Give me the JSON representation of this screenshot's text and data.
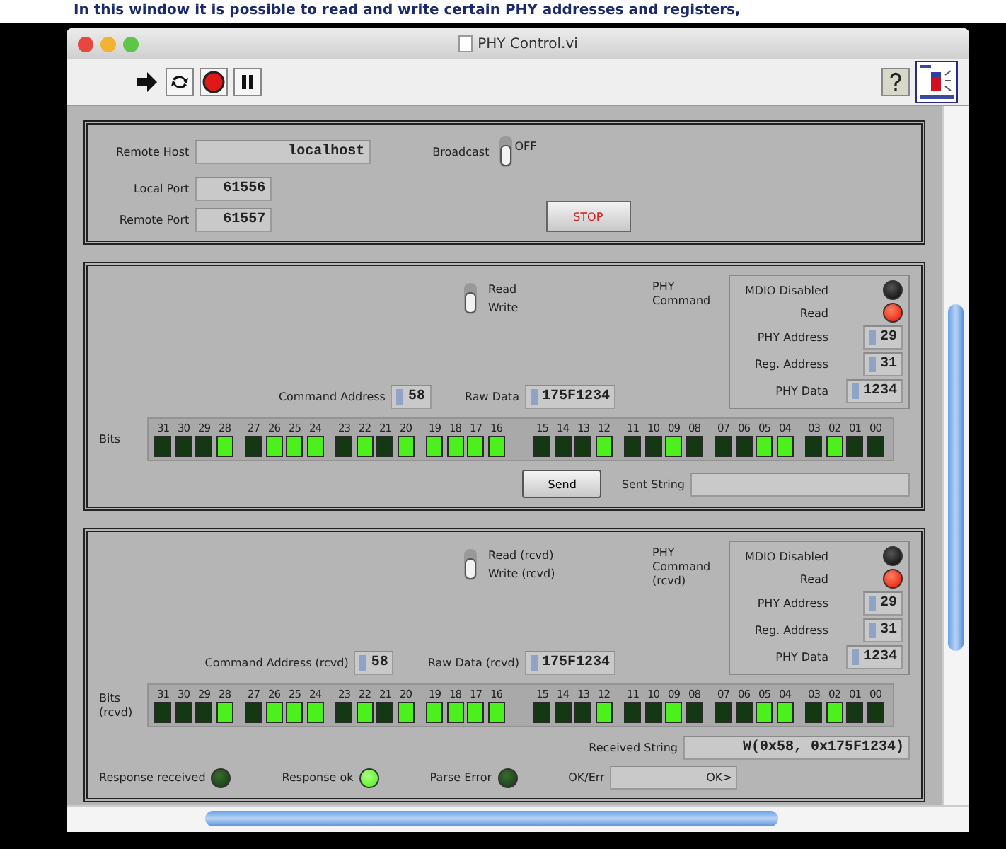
{
  "caption": "In this window it is possible to read and write certain PHY addresses and registers,",
  "window": {
    "title": "PHY Control.vi"
  },
  "connection": {
    "remote_host": {
      "label": "Remote Host",
      "value": "localhost"
    },
    "local_port": {
      "label": "Local Port",
      "value": "61556"
    },
    "remote_port": {
      "label": "Remote Port",
      "value": "61557"
    },
    "broadcast": {
      "label": "Broadcast",
      "state": "OFF",
      "on": false
    },
    "stop_button": "STOP"
  },
  "send": {
    "switch": {
      "top_label": "Read",
      "bottom_label": "Write",
      "down": true
    },
    "command_label": "PHY Command",
    "mdio": {
      "leds": [
        {
          "label": "MDIO Disabled",
          "on": false
        },
        {
          "label": "Read",
          "on": true
        }
      ],
      "fields": [
        {
          "label": "PHY Address",
          "value": "29"
        },
        {
          "label": "Reg. Address",
          "value": "31"
        },
        {
          "label": "PHY Data",
          "value": "1234"
        }
      ]
    },
    "command_address": {
      "label": "Command Address",
      "value": "58"
    },
    "raw_data": {
      "label": "Raw Data",
      "value": "175F1234"
    },
    "bits_label": "Bits",
    "bits": [
      {
        "label": "31",
        "on": false
      },
      {
        "label": "30",
        "on": false
      },
      {
        "label": "29",
        "on": false
      },
      {
        "label": "28",
        "on": true
      },
      {
        "label": "27",
        "on": false
      },
      {
        "label": "26",
        "on": true
      },
      {
        "label": "25",
        "on": true
      },
      {
        "label": "24",
        "on": true
      },
      {
        "label": "23",
        "on": false
      },
      {
        "label": "22",
        "on": true
      },
      {
        "label": "21",
        "on": false
      },
      {
        "label": "20",
        "on": true
      },
      {
        "label": "19",
        "on": true
      },
      {
        "label": "18",
        "on": true
      },
      {
        "label": "17",
        "on": true
      },
      {
        "label": "16",
        "on": true
      },
      {
        "label": "15",
        "on": false
      },
      {
        "label": "14",
        "on": false
      },
      {
        "label": "13",
        "on": false
      },
      {
        "label": "12",
        "on": true
      },
      {
        "label": "11",
        "on": false
      },
      {
        "label": "10",
        "on": false
      },
      {
        "label": "09",
        "on": true
      },
      {
        "label": "08",
        "on": false
      },
      {
        "label": "07",
        "on": false
      },
      {
        "label": "06",
        "on": false
      },
      {
        "label": "05",
        "on": true
      },
      {
        "label": "04",
        "on": true
      },
      {
        "label": "03",
        "on": false
      },
      {
        "label": "02",
        "on": true
      },
      {
        "label": "01",
        "on": false
      },
      {
        "label": "00",
        "on": false
      }
    ],
    "send_button": "Send",
    "sent_string": {
      "label": "Sent String"
    }
  },
  "receive": {
    "switch": {
      "top_label": "Read (rcvd)",
      "bottom_label": "Write (rcvd)",
      "down": true
    },
    "command_label": "PHY Command (rcvd)",
    "mdio": {
      "leds": [
        {
          "label": "MDIO Disabled",
          "on": false
        },
        {
          "label": "Read",
          "on": true
        }
      ],
      "fields": [
        {
          "label": "PHY Address",
          "value": "29"
        },
        {
          "label": "Reg. Address",
          "value": "31"
        },
        {
          "label": "PHY Data",
          "value": "1234"
        }
      ]
    },
    "command_address": {
      "label": "Command Address (rcvd)",
      "value": "58"
    },
    "raw_data": {
      "label": "Raw Data (rcvd)",
      "value": "175F1234"
    },
    "bits_label": "Bits (rcvd)",
    "bits": [
      {
        "label": "31",
        "on": false
      },
      {
        "label": "30",
        "on": false
      },
      {
        "label": "29",
        "on": false
      },
      {
        "label": "28",
        "on": true
      },
      {
        "label": "27",
        "on": false
      },
      {
        "label": "26",
        "on": true
      },
      {
        "label": "25",
        "on": true
      },
      {
        "label": "24",
        "on": true
      },
      {
        "label": "23",
        "on": false
      },
      {
        "label": "22",
        "on": true
      },
      {
        "label": "21",
        "on": false
      },
      {
        "label": "20",
        "on": true
      },
      {
        "label": "19",
        "on": true
      },
      {
        "label": "18",
        "on": true
      },
      {
        "label": "17",
        "on": true
      },
      {
        "label": "16",
        "on": true
      },
      {
        "label": "15",
        "on": false
      },
      {
        "label": "14",
        "on": false
      },
      {
        "label": "13",
        "on": false
      },
      {
        "label": "12",
        "on": true
      },
      {
        "label": "11",
        "on": false
      },
      {
        "label": "10",
        "on": false
      },
      {
        "label": "09",
        "on": true
      },
      {
        "label": "08",
        "on": false
      },
      {
        "label": "07",
        "on": false
      },
      {
        "label": "06",
        "on": false
      },
      {
        "label": "05",
        "on": true
      },
      {
        "label": "04",
        "on": true
      },
      {
        "label": "03",
        "on": false
      },
      {
        "label": "02",
        "on": true
      },
      {
        "label": "01",
        "on": false
      },
      {
        "label": "00",
        "on": false
      }
    ],
    "received_string": {
      "label": "Received String",
      "value": "W(0x58, 0x175F1234)"
    },
    "indicators": [
      {
        "label": "Response received",
        "on": false
      },
      {
        "label": "Response ok",
        "on": true
      },
      {
        "label": "Parse Error",
        "on": false
      }
    ],
    "ok_err": {
      "label": "OK/Err",
      "value": "OK>"
    }
  }
}
